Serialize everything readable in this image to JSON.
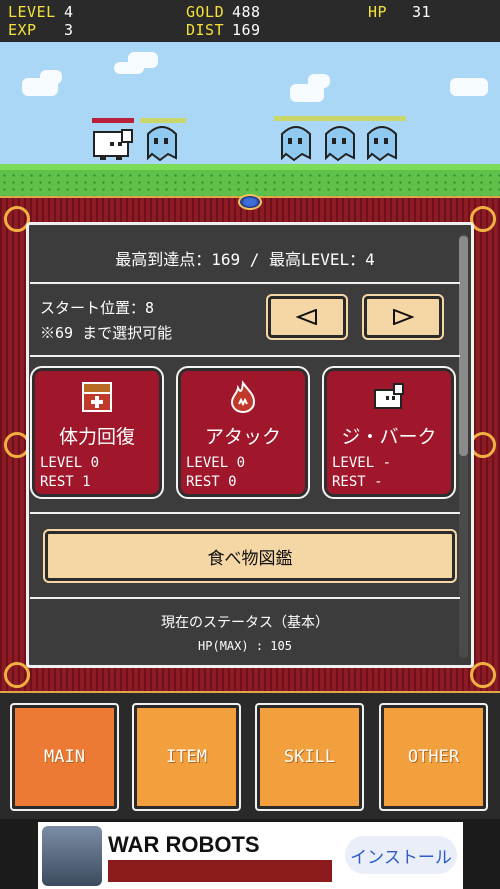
{
  "hud": {
    "level_label": "LEVEL",
    "level_value": "4",
    "exp_label": "EXP",
    "exp_value": "3",
    "gold_label": "GOLD",
    "gold_value": "488",
    "dist_label": "DIST",
    "dist_value": "169",
    "hp_label": "HP",
    "hp_value": "31"
  },
  "panel": {
    "best_record": "最高到達点：169 / 最高LEVEL：4",
    "start_position": "スタート位置：8",
    "selectable_note": "※69 まで選択可能"
  },
  "skills": [
    {
      "name": "体力回復",
      "level": "LEVEL 0",
      "rest": "REST  1",
      "icon": "treasure-chest-icon"
    },
    {
      "name": "アタック",
      "level": "LEVEL 0",
      "rest": "REST  0",
      "icon": "fire-icon"
    },
    {
      "name": "ジ・バーク",
      "level": "LEVEL -",
      "rest": "REST  -",
      "icon": "white-creature-icon"
    }
  ],
  "food_button": "食べ物図鑑",
  "status": {
    "title": "現在のステータス（基本）",
    "hp_max": "HP(MAX) : 105"
  },
  "nav": {
    "main": "MAIN",
    "item": "ITEM",
    "skill": "SKILL",
    "other": "OTHER"
  },
  "ad": {
    "title": "WAR ROBOTS",
    "install": "インストール"
  },
  "colors": {
    "skill_card": "#a0172c",
    "nav_active": "#ec7a34",
    "nav_default": "#f2a03d",
    "hud_label": "#f4e23a"
  }
}
